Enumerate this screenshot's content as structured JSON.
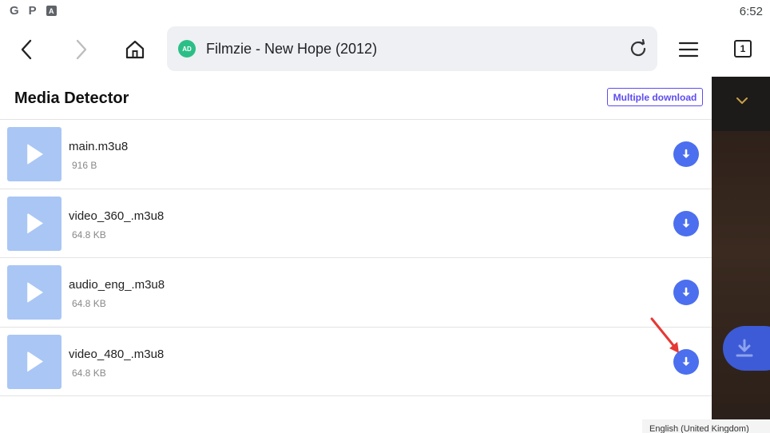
{
  "status_bar": {
    "icons": [
      "G",
      "P",
      "A"
    ],
    "time": "6:52"
  },
  "browser": {
    "page_title": "Filmzie - New Hope (2012)",
    "site_badge": "AD",
    "tab_count": "1"
  },
  "panel": {
    "title": "Media Detector",
    "multiple_download_label": "Multiple download",
    "items": [
      {
        "name": "main.m3u8",
        "size": "916 B"
      },
      {
        "name": "video_360_.m3u8",
        "size": "64.8 KB"
      },
      {
        "name": "audio_eng_.m3u8",
        "size": "64.8 KB"
      },
      {
        "name": "video_480_.m3u8",
        "size": "64.8 KB"
      }
    ]
  },
  "language_tooltip": "English (United Kingdom)",
  "colors": {
    "accent": "#4b6fee",
    "multi_border": "#5d4cf0",
    "thumb": "#a9c6f5",
    "annotation_arrow": "#e53935"
  }
}
